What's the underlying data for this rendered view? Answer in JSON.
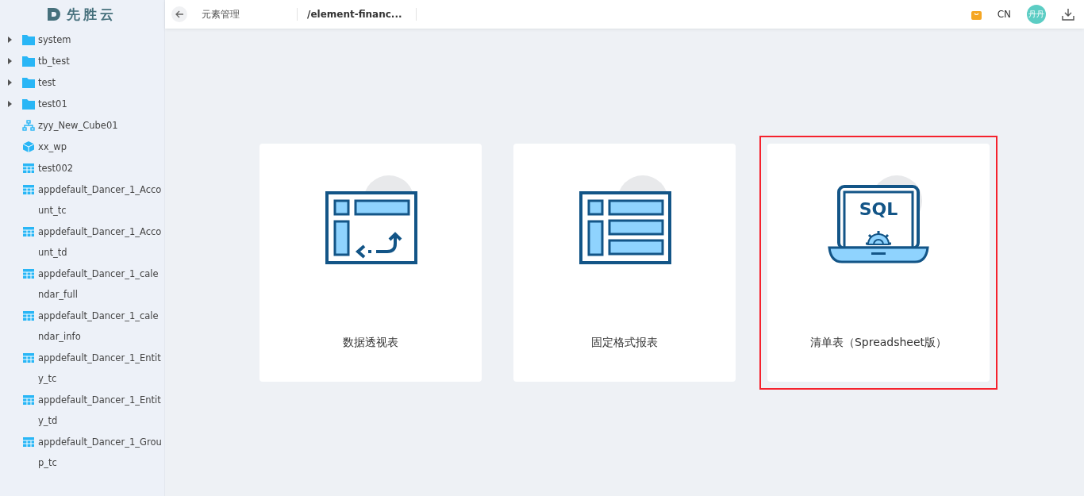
{
  "logo": {
    "text": "先胜云"
  },
  "sidebar": {
    "items": [
      {
        "kind": "folder",
        "label": "system",
        "expanded": false
      },
      {
        "kind": "folder",
        "label": "tb_test",
        "expanded": false
      },
      {
        "kind": "folder",
        "label": "test",
        "expanded": false
      },
      {
        "kind": "folder",
        "label": "test01",
        "expanded": false
      },
      {
        "kind": "model",
        "label": "zyy_New_Cube01"
      },
      {
        "kind": "cube",
        "label": "xx_wp"
      },
      {
        "kind": "table",
        "label": "test002"
      },
      {
        "kind": "table",
        "label": "appdefault_Dancer_1_Account_tc"
      },
      {
        "kind": "table",
        "label": "appdefault_Dancer_1_Account_td"
      },
      {
        "kind": "table",
        "label": "appdefault_Dancer_1_calendar_full"
      },
      {
        "kind": "table",
        "label": "appdefault_Dancer_1_calendar_info"
      },
      {
        "kind": "table",
        "label": "appdefault_Dancer_1_Entity_tc"
      },
      {
        "kind": "table",
        "label": "appdefault_Dancer_1_Entity_td"
      },
      {
        "kind": "table",
        "label": "appdefault_Dancer_1_Group_tc"
      }
    ]
  },
  "header": {
    "title": "元素管理",
    "path": "/element-financ...",
    "language": "CN",
    "avatar": "丹丹"
  },
  "cards": [
    {
      "kind": "pivot",
      "label": "数据透视表",
      "selected": false
    },
    {
      "kind": "fixed",
      "label": "固定格式报表",
      "selected": false
    },
    {
      "kind": "sql",
      "label": "清单表（Spreadsheet版）",
      "icon_text": "SQL",
      "selected": true
    }
  ]
}
